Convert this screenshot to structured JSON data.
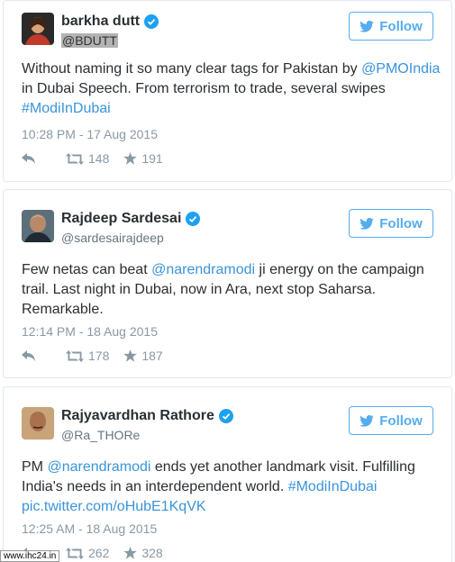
{
  "tweets": [
    {
      "name": "barkha dutt",
      "handle": "@BDUTT",
      "follow_label": "Follow",
      "text_parts": [
        {
          "t": "Without naming it so many clear tags for Pakistan by ",
          "link": false
        },
        {
          "t": "@PMOIndia",
          "link": true
        },
        {
          "t": " in Dubai Speech. From terrorism to trade, several swipes ",
          "link": false
        },
        {
          "t": "#ModiInDubai",
          "link": true
        }
      ],
      "timestamp": "10:28 PM - 17 Aug 2015",
      "retweets": "148",
      "favorites": "191"
    },
    {
      "name": "Rajdeep Sardesai",
      "handle": "@sardesairajdeep",
      "follow_label": "Follow",
      "text_parts": [
        {
          "t": "Few netas can beat ",
          "link": false
        },
        {
          "t": "@narendramodi",
          "link": true
        },
        {
          "t": " ji energy on the campaign trail. Last night in Dubai, now in Ara, next stop Saharsa. Remarkable.",
          "link": false
        }
      ],
      "timestamp": "12:14 PM - 18 Aug 2015",
      "retweets": "178",
      "favorites": "187"
    },
    {
      "name": "Rajyavardhan Rathore",
      "handle": "@Ra_THORe",
      "follow_label": "Follow",
      "text_parts": [
        {
          "t": "PM ",
          "link": false
        },
        {
          "t": "@narendramodi",
          "link": true
        },
        {
          "t": " ends yet another landmark visit. Fulfilling India's needs in an interdependent world. ",
          "link": false
        },
        {
          "t": "#ModiInDubai",
          "link": true
        },
        {
          "t": " ",
          "link": false
        },
        {
          "t": "pic.twitter.com/oHubE1KqVK",
          "link": true
        }
      ],
      "timestamp": "12:25 AM - 18 Aug 2015",
      "retweets": "262",
      "favorites": "328"
    }
  ],
  "watermark": "www.ihc24.in",
  "colors": {
    "accent": "#55acee",
    "link": "#3b94d9",
    "verified": "#1da1f2",
    "muted": "#8899a6"
  },
  "icons": [
    "twitter-bird-icon",
    "verified-badge-icon",
    "reply-icon",
    "retweet-icon",
    "favorite-star-icon"
  ]
}
